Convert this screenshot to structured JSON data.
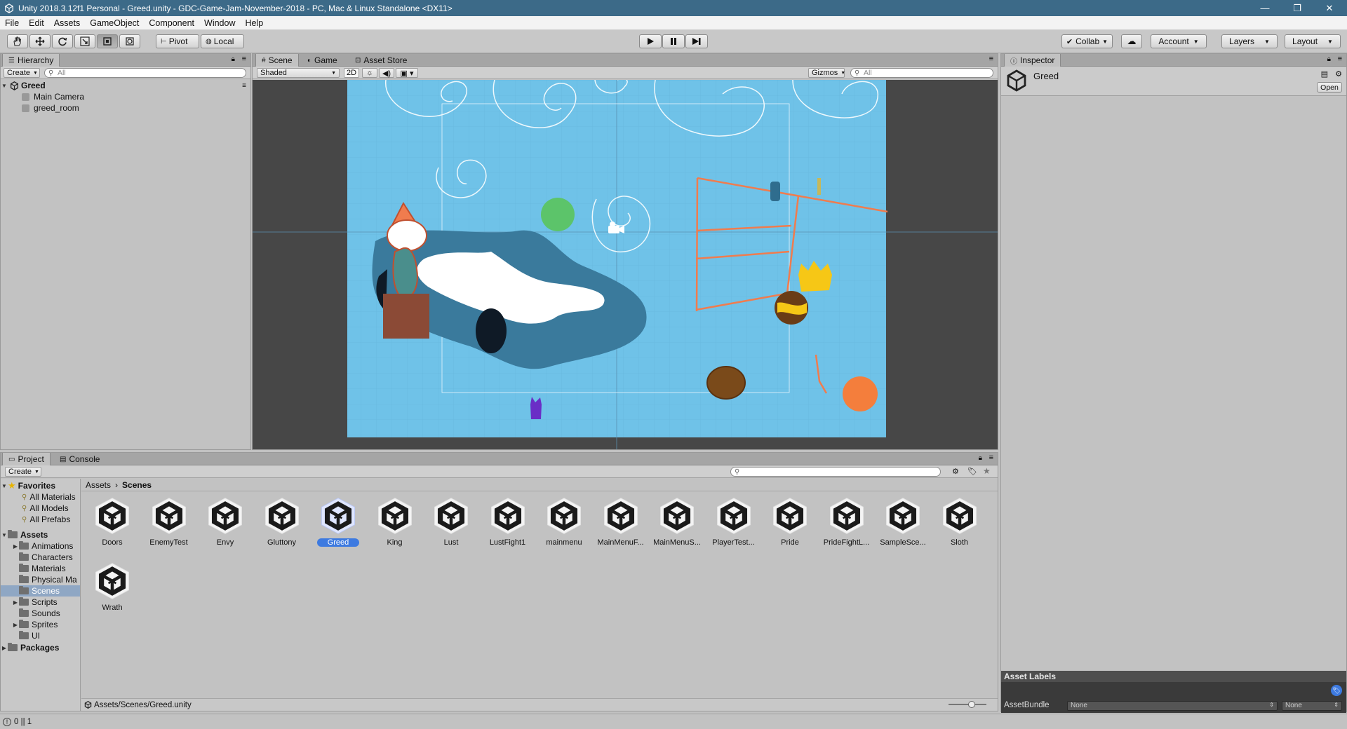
{
  "window": {
    "title": "Unity 2018.3.12f1 Personal - Greed.unity - GDC-Game-Jam-November-2018 - PC, Mac & Linux Standalone <DX11>",
    "min": "—",
    "restore": "❐",
    "close": "✕"
  },
  "menu": [
    "File",
    "Edit",
    "Assets",
    "GameObject",
    "Component",
    "Window",
    "Help"
  ],
  "toolbar": {
    "tools": [
      "hand",
      "move",
      "rotate",
      "scale",
      "rect",
      "transform"
    ],
    "pivot": "Pivot",
    "local": "Local",
    "collab": "Collab",
    "account": "Account",
    "layers": "Layers",
    "layout": "Layout"
  },
  "hierarchy": {
    "tab": "Hierarchy",
    "create": "Create",
    "search_placeholder": "All",
    "scene": "Greed",
    "objects": [
      "Main Camera",
      "greed_room"
    ]
  },
  "scene_view": {
    "tabs": [
      "Scene",
      "Game",
      "Asset Store"
    ],
    "shading": "Shaded",
    "mode_2d": "2D",
    "gizmos": "Gizmos",
    "search_placeholder": "All",
    "background_color": "#6fc2e8",
    "outside_color": "#474747"
  },
  "inspector": {
    "tab": "Inspector",
    "object": "Greed",
    "open": "Open",
    "asset_labels": "Asset Labels",
    "asset_bundle_label": "AssetBundle",
    "asset_bundle_value": "None",
    "asset_bundle_variant": "None"
  },
  "project": {
    "tabs": [
      "Project",
      "Console"
    ],
    "create": "Create",
    "breadcrumb": [
      "Assets",
      "Scenes"
    ],
    "favorites": {
      "label": "Favorites",
      "items": [
        "All Materials",
        "All Models",
        "All Prefabs"
      ]
    },
    "assets": {
      "label": "Assets",
      "folders": [
        "Animations",
        "Characters",
        "Materials",
        "Physical Ma",
        "Scenes",
        "Scripts",
        "Sounds",
        "Sprites",
        "UI"
      ]
    },
    "packages": "Packages",
    "scene_files": [
      "Doors",
      "EnemyTest",
      "Envy",
      "Gluttony",
      "Greed",
      "King",
      "Lust",
      "LustFight1",
      "mainmenu",
      "MainMenuF...",
      "MainMenuS...",
      "PlayerTest...",
      "Pride",
      "PrideFightL...",
      "SampleSce...",
      "Sloth",
      "Wrath"
    ],
    "selected_file": "Greed",
    "path": "Assets/Scenes/Greed.unity"
  },
  "status": {
    "text": "0 || 1"
  }
}
